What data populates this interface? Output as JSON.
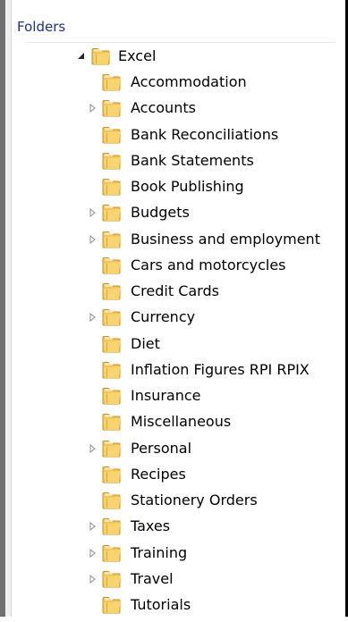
{
  "panel": {
    "title": "Folders"
  },
  "tree": {
    "root": {
      "label": "Excel",
      "expanded": true
    },
    "children": [
      {
        "label": "Accommodation",
        "expandable": false
      },
      {
        "label": "Accounts",
        "expandable": true
      },
      {
        "label": "Bank Reconciliations",
        "expandable": false
      },
      {
        "label": "Bank Statements",
        "expandable": false
      },
      {
        "label": "Book Publishing",
        "expandable": false
      },
      {
        "label": "Budgets",
        "expandable": true
      },
      {
        "label": "Business and employment",
        "expandable": true
      },
      {
        "label": "Cars and motorcycles",
        "expandable": false
      },
      {
        "label": "Credit Cards",
        "expandable": false
      },
      {
        "label": "Currency",
        "expandable": true
      },
      {
        "label": "Diet",
        "expandable": false
      },
      {
        "label": "Inflation Figures RPI RPIX",
        "expandable": false
      },
      {
        "label": "Insurance",
        "expandable": false
      },
      {
        "label": "Miscellaneous",
        "expandable": false
      },
      {
        "label": "Personal",
        "expandable": true
      },
      {
        "label": "Recipes",
        "expandable": false
      },
      {
        "label": "Stationery Orders",
        "expandable": false
      },
      {
        "label": "Taxes",
        "expandable": true
      },
      {
        "label": "Training",
        "expandable": true
      },
      {
        "label": "Travel",
        "expandable": true
      },
      {
        "label": "Tutorials",
        "expandable": false
      }
    ]
  },
  "colors": {
    "header_text": "#1e3287",
    "folder_fill": "#f2c34f",
    "folder_edge": "#c8942a",
    "expander": "#8c8c8c",
    "expander_open": "#262626"
  },
  "icons": {
    "folder": "folder-icon",
    "collapsed": "expand-arrow-icon",
    "expanded": "collapse-arrow-icon"
  }
}
